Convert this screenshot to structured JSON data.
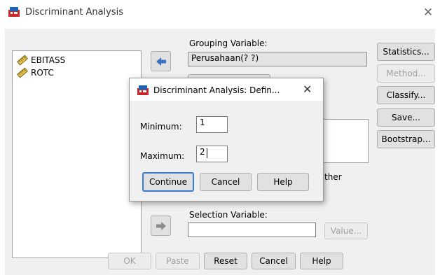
{
  "window": {
    "title": "Discriminant Analysis",
    "icon": "spss-dialog-icon",
    "close_glyph": "✕"
  },
  "variables": [
    {
      "name": "EBITASS",
      "icon": "scale-variable-icon"
    },
    {
      "name": "ROTC",
      "icon": "scale-variable-icon"
    }
  ],
  "grouping": {
    "label": "Grouping Variable:",
    "value": "Perusahaan(? ?)"
  },
  "independents": {
    "partial_label": "ther"
  },
  "selection": {
    "label": "Selection Variable:",
    "value": "",
    "value_button": "Value..."
  },
  "side_buttons": {
    "statistics": "Statistics...",
    "method": "Method...",
    "classify": "Classify...",
    "save": "Save...",
    "bootstrap": "Bootstrap..."
  },
  "bottom_buttons": {
    "ok": "OK",
    "paste": "Paste",
    "reset": "Reset",
    "cancel": "Cancel",
    "help": "Help"
  },
  "define_range": {
    "title": "Discriminant Analysis: Defin...",
    "close_glyph": "✕",
    "minimum_label": "Minimum:",
    "minimum_value": "1",
    "maximum_label": "Maximum:",
    "maximum_value": "2",
    "continue": "Continue",
    "cancel": "Cancel",
    "help": "Help"
  },
  "colors": {
    "accent": "#3a7bd5",
    "arrow": "#3b6fc2",
    "arrow_disabled": "#8a8a8a"
  }
}
